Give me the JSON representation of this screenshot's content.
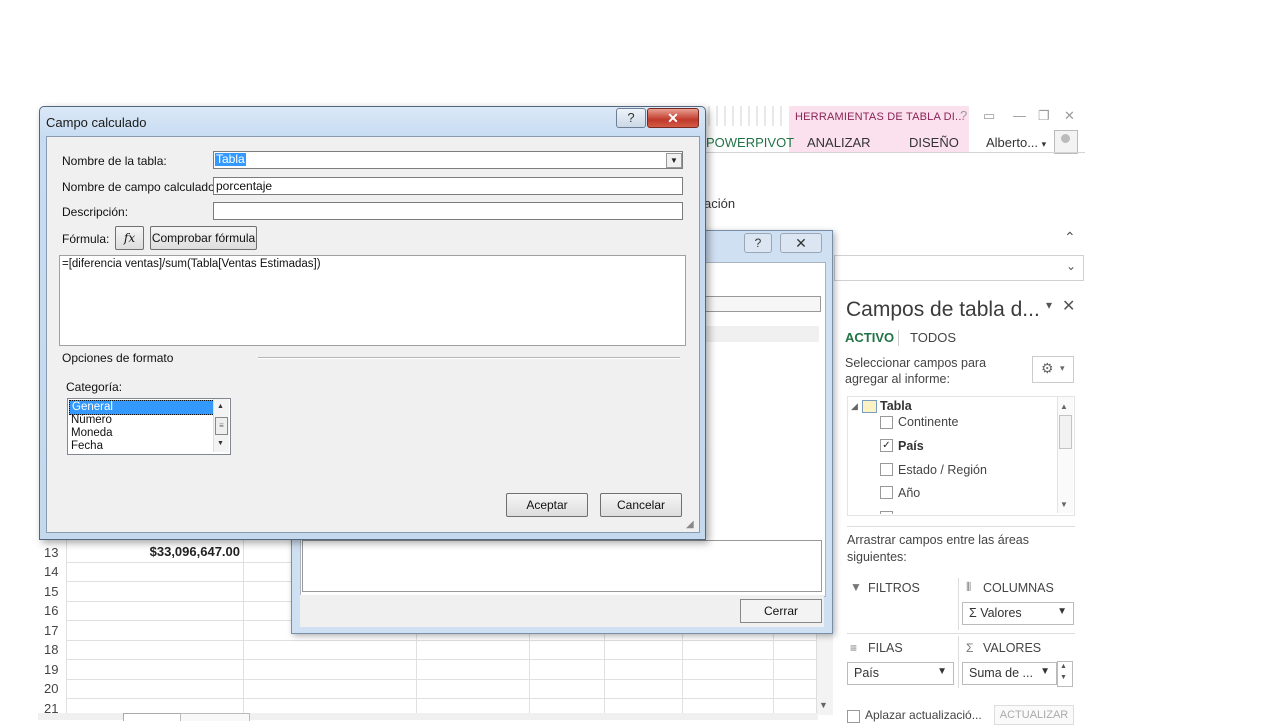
{
  "excel": {
    "contextual_tab": "HERRAMIENTAS DE TABLA DI...",
    "window_controls": [
      "?",
      "▭",
      "—",
      "❐",
      "✕"
    ],
    "tabs": [
      "POWERPIVOT",
      "ANALIZAR",
      "DISEÑO"
    ],
    "user": "Alberto...",
    "ribbon_fragment": "ación",
    "accent_color": "#217346",
    "rows": [
      "13",
      "14",
      "15",
      "16",
      "17",
      "18",
      "19",
      "20",
      "21"
    ],
    "cell_value": "$33,096,647.00"
  },
  "pivot_panel": {
    "title": "Campos de tabla d...",
    "tab_active": "ACTIVO",
    "tab_all": "TODOS",
    "select_text": "Seleccionar campos para agregar al informe:",
    "table_name": "Tabla",
    "fields": [
      {
        "label": "Continente",
        "checked": false
      },
      {
        "label": "País",
        "checked": true
      },
      {
        "label": "Estado / Región",
        "checked": false
      },
      {
        "label": "Año",
        "checked": false
      }
    ],
    "drag_text": "Arrastrar campos entre las áreas siguientes:",
    "areas": {
      "filters": "FILTROS",
      "columns": "COLUMNAS",
      "rows": "FILAS",
      "values": "VALORES"
    },
    "columns_value": "Σ Valores",
    "rows_value": "País",
    "values_value": "Suma de ...",
    "defer_label": "Aplazar actualizació...",
    "update_button": "ACTUALIZAR"
  },
  "back_dialog": {
    "close_button": "Cerrar"
  },
  "dialog": {
    "title": "Campo calculado",
    "table_label": "Nombre de la tabla:",
    "table_value": "Tabla",
    "field_label": "Nombre de campo calculado:",
    "field_value": "porcentaje",
    "desc_label": "Descripción:",
    "desc_value": "",
    "formula_label": "Fórmula:",
    "fx_button": "fx",
    "check_button": "Comprobar fórmula",
    "formula": "=[diferencia ventas]/sum(Tabla[Ventas Estimadas])",
    "format_options": "Opciones de formato",
    "category_label": "Categoría:",
    "categories": [
      "General",
      "Número",
      "Moneda",
      "Fecha"
    ],
    "selected_category": "General",
    "ok_button": "Aceptar",
    "cancel_button": "Cancelar"
  }
}
